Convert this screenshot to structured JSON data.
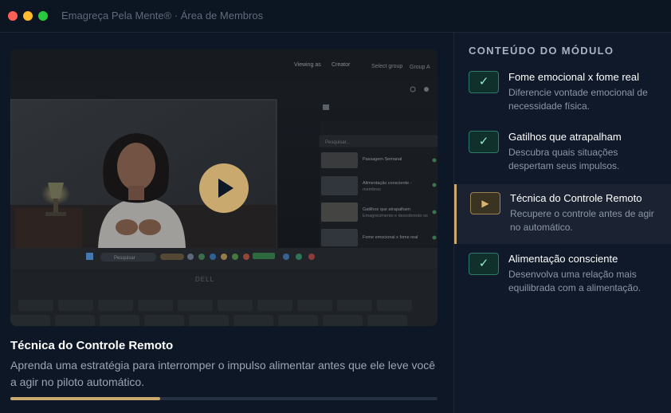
{
  "window": {
    "title": "Emagreça Pela Mente® · Área de Membros"
  },
  "player": {
    "screen_texts": {
      "viewing_as": "Viewing as",
      "creator": "Creator",
      "select_group": "Select group",
      "group": "Group A",
      "search_hint": "Pesquisar...",
      "taskbar_search": "Pesquisar",
      "laptop_brand": "DELL",
      "row1": "Passagem Semanal",
      "row2a": "Alimentação consciente -",
      "row2b": "membros",
      "row3a": "Gatilhos que atrapalham",
      "row3b": "Emagrecimento e descobrindo os",
      "row4": "Fome emocional x fome real"
    },
    "progress_fraction": 0.35
  },
  "lesson": {
    "title": "Técnica do Controle Remoto",
    "description": "Aprenda uma estratégia para interromper o impulso alimentar antes que ele leve você a agir no piloto automático."
  },
  "sidebar": {
    "heading": "CONTEÚDO DO MÓDULO",
    "items": [
      {
        "title": "Fome emocional x fome real",
        "desc": "Diferencie vontade emocional de necessidade física.",
        "status": "done",
        "icon": "check-icon"
      },
      {
        "title": "Gatilhos que atrapalham",
        "desc": "Descubra quais situações despertam seus impulsos.",
        "status": "done",
        "icon": "check-icon"
      },
      {
        "title": "Técnica do Controle Remoto",
        "desc": "Recupere o controle antes de agir no automático.",
        "status": "current",
        "icon": "play-icon"
      },
      {
        "title": "Alimentação consciente",
        "desc": "Desenvolva uma relação mais equilibrada com a alimentação.",
        "status": "done",
        "icon": "check-icon"
      }
    ]
  },
  "colors": {
    "accent": "#c9a96e",
    "done": "#2f7a6b",
    "background": "#0d1726"
  }
}
